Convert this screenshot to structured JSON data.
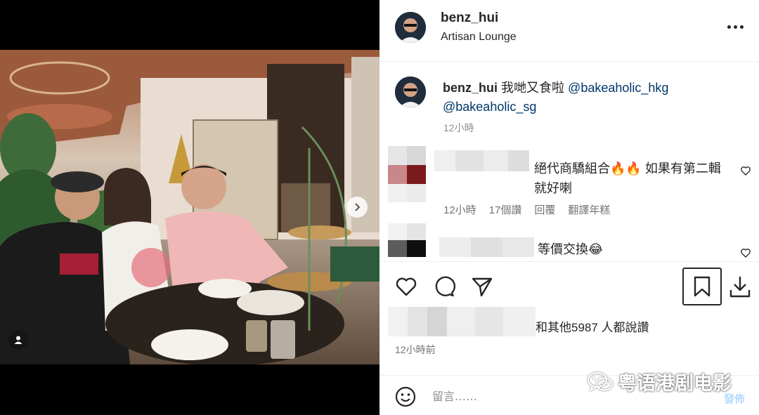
{
  "post": {
    "username": "benz_hui",
    "location": "Artisan Lounge"
  },
  "caption": {
    "username": "benz_hui",
    "text": "我哋又食啦",
    "mention1": "@bakeaholic_hkg",
    "mention2": "@bakeaholic_sg",
    "time": "12小時"
  },
  "comments": [
    {
      "text": "絕代商驕組合🔥🔥 如果有第二輯就好喇",
      "time": "12小時",
      "likes": "17個讚",
      "reply": "回覆",
      "translate": "翻譯年糕"
    },
    {
      "text": "等價交換😂"
    }
  ],
  "likes": {
    "text": "和其他5987 人都說讚"
  },
  "post_time": "12小時前",
  "comment_box": {
    "placeholder": "留言……",
    "post_label": "發佈"
  },
  "watermark": {
    "text": "粤语港剧电影"
  },
  "icons": {
    "more": "more-horizontal-icon",
    "like": "heart-icon",
    "comment": "comment-icon",
    "share": "send-icon",
    "save": "bookmark-icon",
    "download": "download-icon",
    "emoji": "smiley-icon",
    "next": "chevron-right-icon",
    "tag": "user-tag-icon"
  }
}
